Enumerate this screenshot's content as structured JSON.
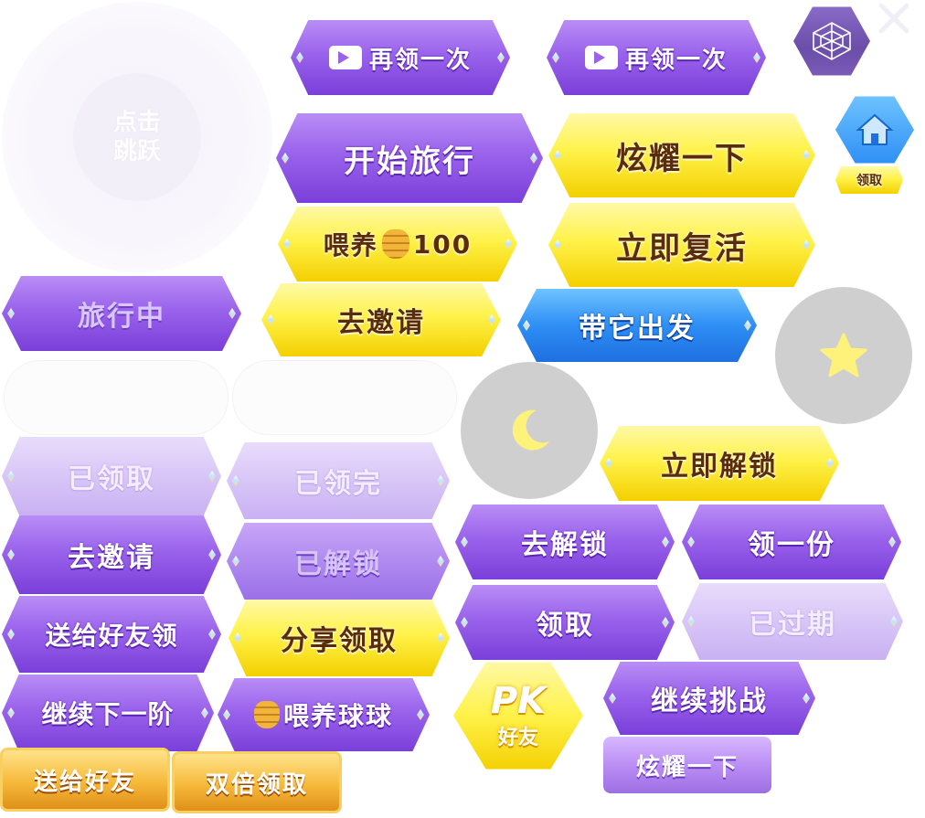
{
  "jump": {
    "line1": "点击",
    "line2": "跳跃"
  },
  "buttons": {
    "again1": "再领一次",
    "again2": "再领一次",
    "start_travel": "开始旅行",
    "show_off": "炫耀一下",
    "feed_label": "喂养",
    "feed_amount": "100",
    "revive": "立即复活",
    "traveling": "旅行中",
    "invite1": "去邀请",
    "take_it_out": "带它出发",
    "unlock_now": "立即解锁",
    "claimed": "已领取",
    "claimed_all": "已领完",
    "invite2": "去邀请",
    "unlocked": "已解锁",
    "go_unlock": "去解锁",
    "get_one": "领一份",
    "send_friend_claim": "送给好友领",
    "share_claim": "分享领取",
    "claim": "领取",
    "expired": "已过期",
    "next_stage": "继续下一阶",
    "feed_ball": "喂养球球",
    "continue_challenge": "继续挑战",
    "send_friend": "送给好友",
    "double_claim": "双倍领取",
    "show_off_small": "炫耀一下",
    "home_claim": "领取",
    "pk_top": "PK",
    "pk_bottom": "好友"
  },
  "colors": {
    "purple": "#8a50e6",
    "yellow": "#fff24a",
    "blue": "#2e8ff5",
    "faded": "#d8c6f7",
    "gold": "#f6b93a",
    "grey_circle": "#cfcfcf",
    "icon_yellow": "#fff27a"
  }
}
